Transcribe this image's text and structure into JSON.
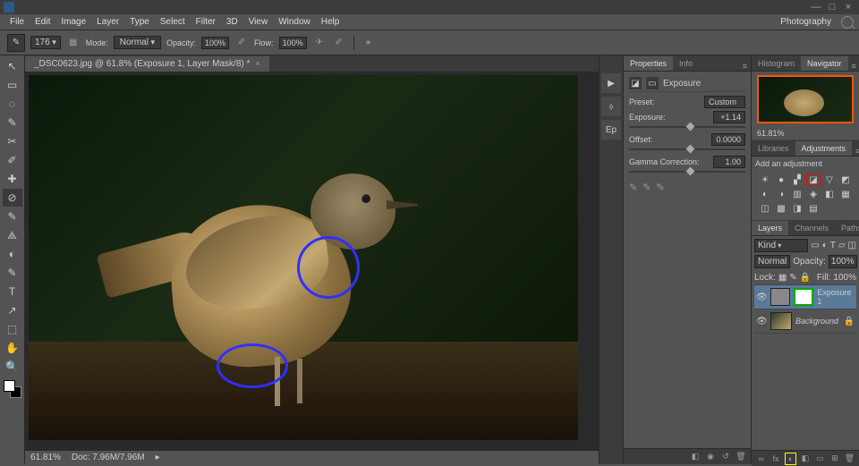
{
  "app": {
    "name": "Ps"
  },
  "window": {
    "min": "—",
    "max": "□",
    "close": "×"
  },
  "menu": [
    "File",
    "Edit",
    "Image",
    "Layer",
    "Type",
    "Select",
    "Filter",
    "3D",
    "View",
    "Window",
    "Help"
  ],
  "workspace": "Photography",
  "options_bar": {
    "brush_size": "176",
    "mode_label": "Mode:",
    "mode": "Normal",
    "opacity_label": "Opacity:",
    "opacity": "100%",
    "flow_label": "Flow:",
    "flow": "100%"
  },
  "document": {
    "tab_title": "_DSC0623.jpg @ 61.8% (Exposure 1, Layer Mask/8) *",
    "zoom": "61.81%",
    "doc_size_label": "Doc: 7.96M/7.96M"
  },
  "tools": [
    "↖",
    "▭",
    "◌",
    "✎",
    "✂",
    "✐",
    "✚",
    "⊘",
    "✎",
    "⟁",
    "◐",
    "✎",
    "T",
    "↗",
    "⬚",
    "✋",
    "🔍"
  ],
  "mid_icons": [
    "▶",
    "⬨",
    "Ep"
  ],
  "panels": {
    "properties": {
      "tabs": [
        "Properties",
        "Info"
      ],
      "title": "Exposure",
      "preset_label": "Preset:",
      "preset": "Custom",
      "exposure_label": "Exposure:",
      "exposure": "+1.14",
      "offset_label": "Offset:",
      "offset": "0.0000",
      "gamma_label": "Gamma Correction:",
      "gamma": "1.00"
    },
    "navigator": {
      "tabs": [
        "Histogram",
        "Navigator"
      ],
      "zoom": "61.81%"
    },
    "adjustments": {
      "tabs": [
        "Libraries",
        "Adjustments"
      ],
      "heading": "Add an adjustment",
      "icons": [
        "☀",
        "●",
        "▞",
        "◪",
        "▽",
        "◩",
        "◐",
        "◑",
        "▥",
        "◈",
        "◧",
        "▦",
        "◫",
        "▩",
        "◨",
        "▤"
      ]
    },
    "layers": {
      "tabs": [
        "Layers",
        "Channels",
        "Paths"
      ],
      "kind": "Kind",
      "blend": "Normal",
      "opacity_label": "Opacity:",
      "opacity": "100%",
      "lock_label": "Lock:",
      "fill_label": "Fill:",
      "fill": "100%",
      "items": [
        {
          "name": "Exposure 1",
          "active": true,
          "mask": true
        },
        {
          "name": "Background",
          "active": false,
          "locked": true
        }
      ],
      "footer_icons": [
        "∞",
        "fx",
        "◐",
        "◧",
        "▭",
        "⊞",
        "🗑"
      ]
    }
  }
}
